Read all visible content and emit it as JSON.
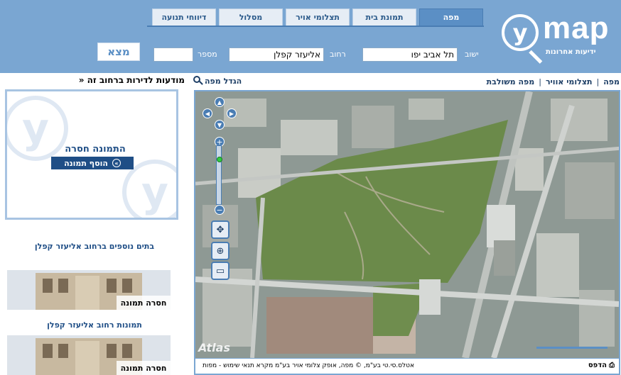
{
  "tabs": [
    {
      "label": "מפה",
      "active": true
    },
    {
      "label": "תמונת בית",
      "active": false
    },
    {
      "label": "תצלומי אויר",
      "active": false
    },
    {
      "label": "מסלול",
      "active": false
    },
    {
      "label": "דיווחי תנועה",
      "active": false
    }
  ],
  "logo": {
    "letter": "y",
    "name": "map",
    "tagline": "ידיעות אחרונות"
  },
  "search": {
    "city_label": "ישוב",
    "city_value": "תל אביב יפו",
    "street_label": "רחוב",
    "street_value": "אליעזר קפלן",
    "number_label": "מספר",
    "number_value": "",
    "find_label": "מצא"
  },
  "map_links": {
    "map": "מפה",
    "aerial": "תצלומי אוויר",
    "combined": "מפה משולבת",
    "separator": "|"
  },
  "enlarge_label": "הגדל מפה",
  "map": {
    "atlas_watermark": "Atlas",
    "print_label": "הדפס",
    "copyright": "אטלס.סי.טי בע\"מ, © מפה, אופק צלומי אויר בע\"מ  מקרא  תנאי שימוש - מפות"
  },
  "left_panel": {
    "title": "מודעות לדירות ברחוב זה «",
    "missing_photo": "התמונה חסרה",
    "add_photo": "הוסף תמונה",
    "more_houses_title": "בתים נוספים ברחוב אליעזר קפלן",
    "street_photos_title": "תמונות רחוב אליעזר קפלן",
    "thumb_missing_1": "חסרה תמונה",
    "thumb_missing_2": "חסרה תמונה"
  },
  "colors": {
    "header_bg": "#7aa6d2",
    "accent": "#1f4e86",
    "active_tab": "#5b8fc5"
  }
}
